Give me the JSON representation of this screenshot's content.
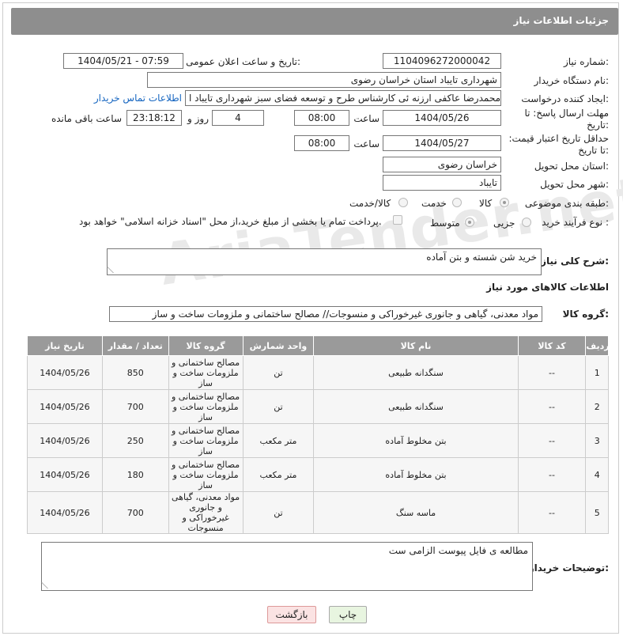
{
  "header": {
    "title": "جزئیات اطلاعات نیاز"
  },
  "fields": {
    "need_number_label": "شماره نیاز:",
    "need_number": "1104096272000042",
    "announce_label": "تاریخ و ساعت اعلان عمومی:",
    "announce_value": "1404/05/21 - 07:59",
    "buyer_org_label": "نام دستگاه خریدار:",
    "buyer_org": "شهرداری تایباد استان خراسان رضوی",
    "creator_label": "ایجاد کننده درخواست:",
    "creator": "محمدرضا عاکفی ارزنه ئی کارشناس طرح و توسعه فضای سبز شهرداری تایباد ا",
    "contact_link": "اطلاعات تماس خریدار",
    "deadline_label": "مهلت ارسال پاسخ: تا تاریخ:",
    "deadline_date": "1404/05/26",
    "time_word": "ساعت",
    "deadline_time": "08:00",
    "days_value": "4",
    "days_word": "روز و",
    "remaining_time": "23:18:12",
    "remaining_word": "ساعت باقی مانده",
    "price_validity_label": "حداقل تاریخ اعتبار قیمت: تا تاریخ:",
    "price_date": "1404/05/27",
    "price_time": "08:00",
    "province_label": "استان محل تحویل:",
    "province": "خراسان رضوی",
    "city_label": "شهر محل تحویل:",
    "city": "تایباد",
    "category_label": "طبقه بندی موضوعی:",
    "cat_options": [
      "کالا",
      "خدمت",
      "کالا/خدمت"
    ],
    "process_label": "نوع فرآیند خرید :",
    "process_options": [
      "جزیی",
      "متوسط"
    ],
    "payment_note": "پرداخت تمام یا بخشی از مبلغ خرید،از محل \"اسناد خزانه اسلامی\" خواهد بود.",
    "description_label": "شرح کلی نیاز:",
    "description": "خرید شن شسته و بتن آماده",
    "items_title": "اطلاعات کالاهای مورد نیاز",
    "goods_group_label": "گروه کالا:",
    "goods_group": "مواد معدنی، گیاهی و جانوری غیرخوراکی و منسوجات// مصالح ساختمانی و ملزومات ساخت و ساز",
    "buyer_notes_label": "توضیحات خریدار:",
    "buyer_notes": "مطالعه ی فایل پیوست الزامی ست"
  },
  "table": {
    "headers": [
      "ردیف",
      "کد کالا",
      "نام کالا",
      "واحد شمارش",
      "گروه کالا",
      "تعداد / مقدار",
      "تاریخ نیاز"
    ],
    "rows": [
      [
        "1",
        "--",
        "سنگدانه طبیعی",
        "تن",
        "مصالح ساختمانی و ملزومات ساخت و ساز",
        "850",
        "1404/05/26"
      ],
      [
        "2",
        "--",
        "سنگدانه طبیعی",
        "تن",
        "مصالح ساختمانی و ملزومات ساخت و ساز",
        "700",
        "1404/05/26"
      ],
      [
        "3",
        "--",
        "بتن مخلوط آماده",
        "متر مکعب",
        "مصالح ساختمانی و ملزومات ساخت و ساز",
        "250",
        "1404/05/26"
      ],
      [
        "4",
        "--",
        "بتن مخلوط آماده",
        "متر مکعب",
        "مصالح ساختمانی و ملزومات ساخت و ساز",
        "180",
        "1404/05/26"
      ],
      [
        "5",
        "--",
        "ماسه سنگ",
        "تن",
        "مواد معدنی، گیاهی و جانوری غیرخوراکی و منسوجات",
        "700",
        "1404/05/26"
      ]
    ]
  },
  "buttons": {
    "print": "چاپ",
    "back": "بازگشت"
  },
  "watermark": "AriaTender.net"
}
